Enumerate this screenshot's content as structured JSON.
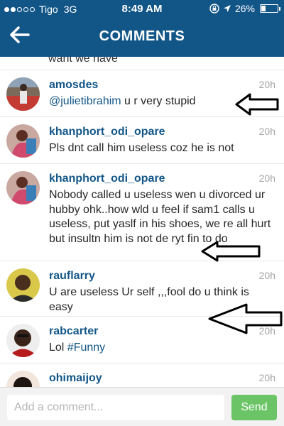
{
  "status_bar": {
    "carrier": "Tigo",
    "network": "3G",
    "time": "8:49 AM",
    "battery": "26%",
    "icons": [
      "signal-dots-icon",
      "rotation-lock-icon",
      "location-arrow-icon",
      "battery-icon"
    ]
  },
  "header": {
    "title": "COMMENTS",
    "back_icon": "back-arrow-icon",
    "color": "#125688"
  },
  "comments_list": {
    "partial_top_text": "want we have",
    "items": [
      {
        "username": "amosdes",
        "time": "20h",
        "mention": "@julietibrahim",
        "text": " u r very stupid"
      },
      {
        "username": "khanphort_odi_opare",
        "time": "20h",
        "text": "Pls dnt call him useless coz he is not"
      },
      {
        "username": "khanphort_odi_opare",
        "time": "20h",
        "text": "Nobody called u useless wen u divorced ur hubby ohk..how wld u feel if sam1 calls u useless, put yaslf in his shoes, we  re all hurt but insultn him is not de ryt fin to do"
      },
      {
        "username": "rauflarry",
        "time": "20h",
        "text": "U are useless Ur self ,,,fool do u think is easy"
      },
      {
        "username": "rabcarter",
        "time": "20h",
        "text": "Lol ",
        "hashtag": "#Funny"
      },
      {
        "username": "ohimaijoy",
        "time": "20h",
        "text": ""
      }
    ]
  },
  "footer": {
    "input_placeholder": "Add a comment...",
    "send_label": "Send",
    "send_color": "#6bc566"
  }
}
